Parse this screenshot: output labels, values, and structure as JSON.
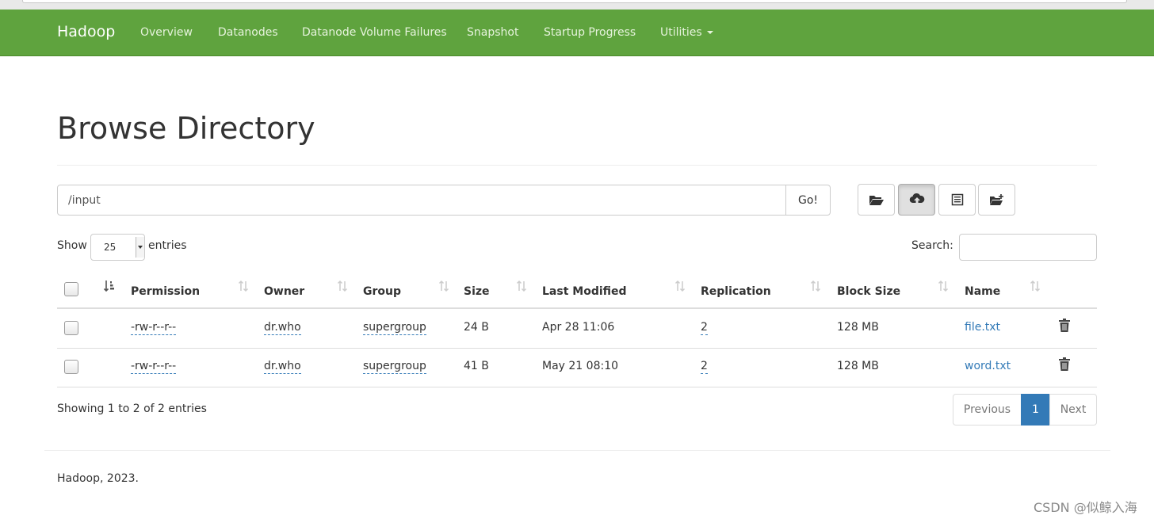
{
  "navbar": {
    "brand": "Hadoop",
    "items": [
      "Overview",
      "Datanodes",
      "Datanode Volume Failures",
      "Snapshot",
      "Startup Progress",
      "Utilities"
    ]
  },
  "page_title": "Browse Directory",
  "path": {
    "value": "/input",
    "go_label": "Go!"
  },
  "toolbar": {
    "icons": [
      "folder-open-icon",
      "cloud-upload-icon",
      "list-icon",
      "new-folder-icon"
    ]
  },
  "table_controls": {
    "show_label": "Show",
    "page_length": "25",
    "entries_label": "entries",
    "search_label": "Search:"
  },
  "columns": [
    "Permission",
    "Owner",
    "Group",
    "Size",
    "Last Modified",
    "Replication",
    "Block Size",
    "Name"
  ],
  "rows": [
    {
      "permission": "-rw-r--r--",
      "owner": "dr.who",
      "group": "supergroup",
      "size": "24 B",
      "modified": "Apr 28 11:06",
      "replication": "2",
      "block_size": "128 MB",
      "name": "file.txt"
    },
    {
      "permission": "-rw-r--r--",
      "owner": "dr.who",
      "group": "supergroup",
      "size": "41 B",
      "modified": "May 21 08:10",
      "replication": "2",
      "block_size": "128 MB",
      "name": "word.txt"
    }
  ],
  "info": "Showing 1 to 2 of 2 entries",
  "pagination": {
    "previous": "Previous",
    "current": "1",
    "next": "Next"
  },
  "footer": "Hadoop, 2023.",
  "watermark": "CSDN @似鲸入海",
  "colors": {
    "navbar": "#5fa33e",
    "link": "#337ab7",
    "page_active": "#337ab7"
  }
}
